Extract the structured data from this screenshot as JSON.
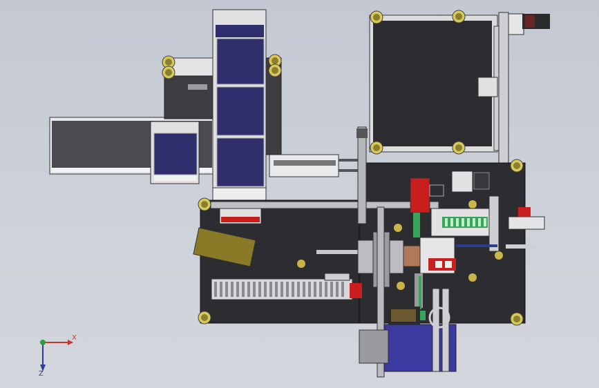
{
  "view": {
    "background_top": "#c4c8d2",
    "background_bottom": "#d3d6dc",
    "frame_color": "#3a3a3e",
    "plate_color": "#2d2d31",
    "hopper_color": "#2f2f6e",
    "accent_red": "#c81e1e",
    "accent_green": "#3aa55a",
    "accent_yellow": "#c9b54a",
    "foot_color": "#d8c95a"
  },
  "axes": {
    "x_label": "X",
    "z_label": "Z",
    "x_color": "#c0392b",
    "y_color": "#2e9e40",
    "z_color": "#2c3e91"
  },
  "icons": [
    "coordinate-triad-icon",
    "leveling-foot-icon",
    "motor-icon"
  ]
}
